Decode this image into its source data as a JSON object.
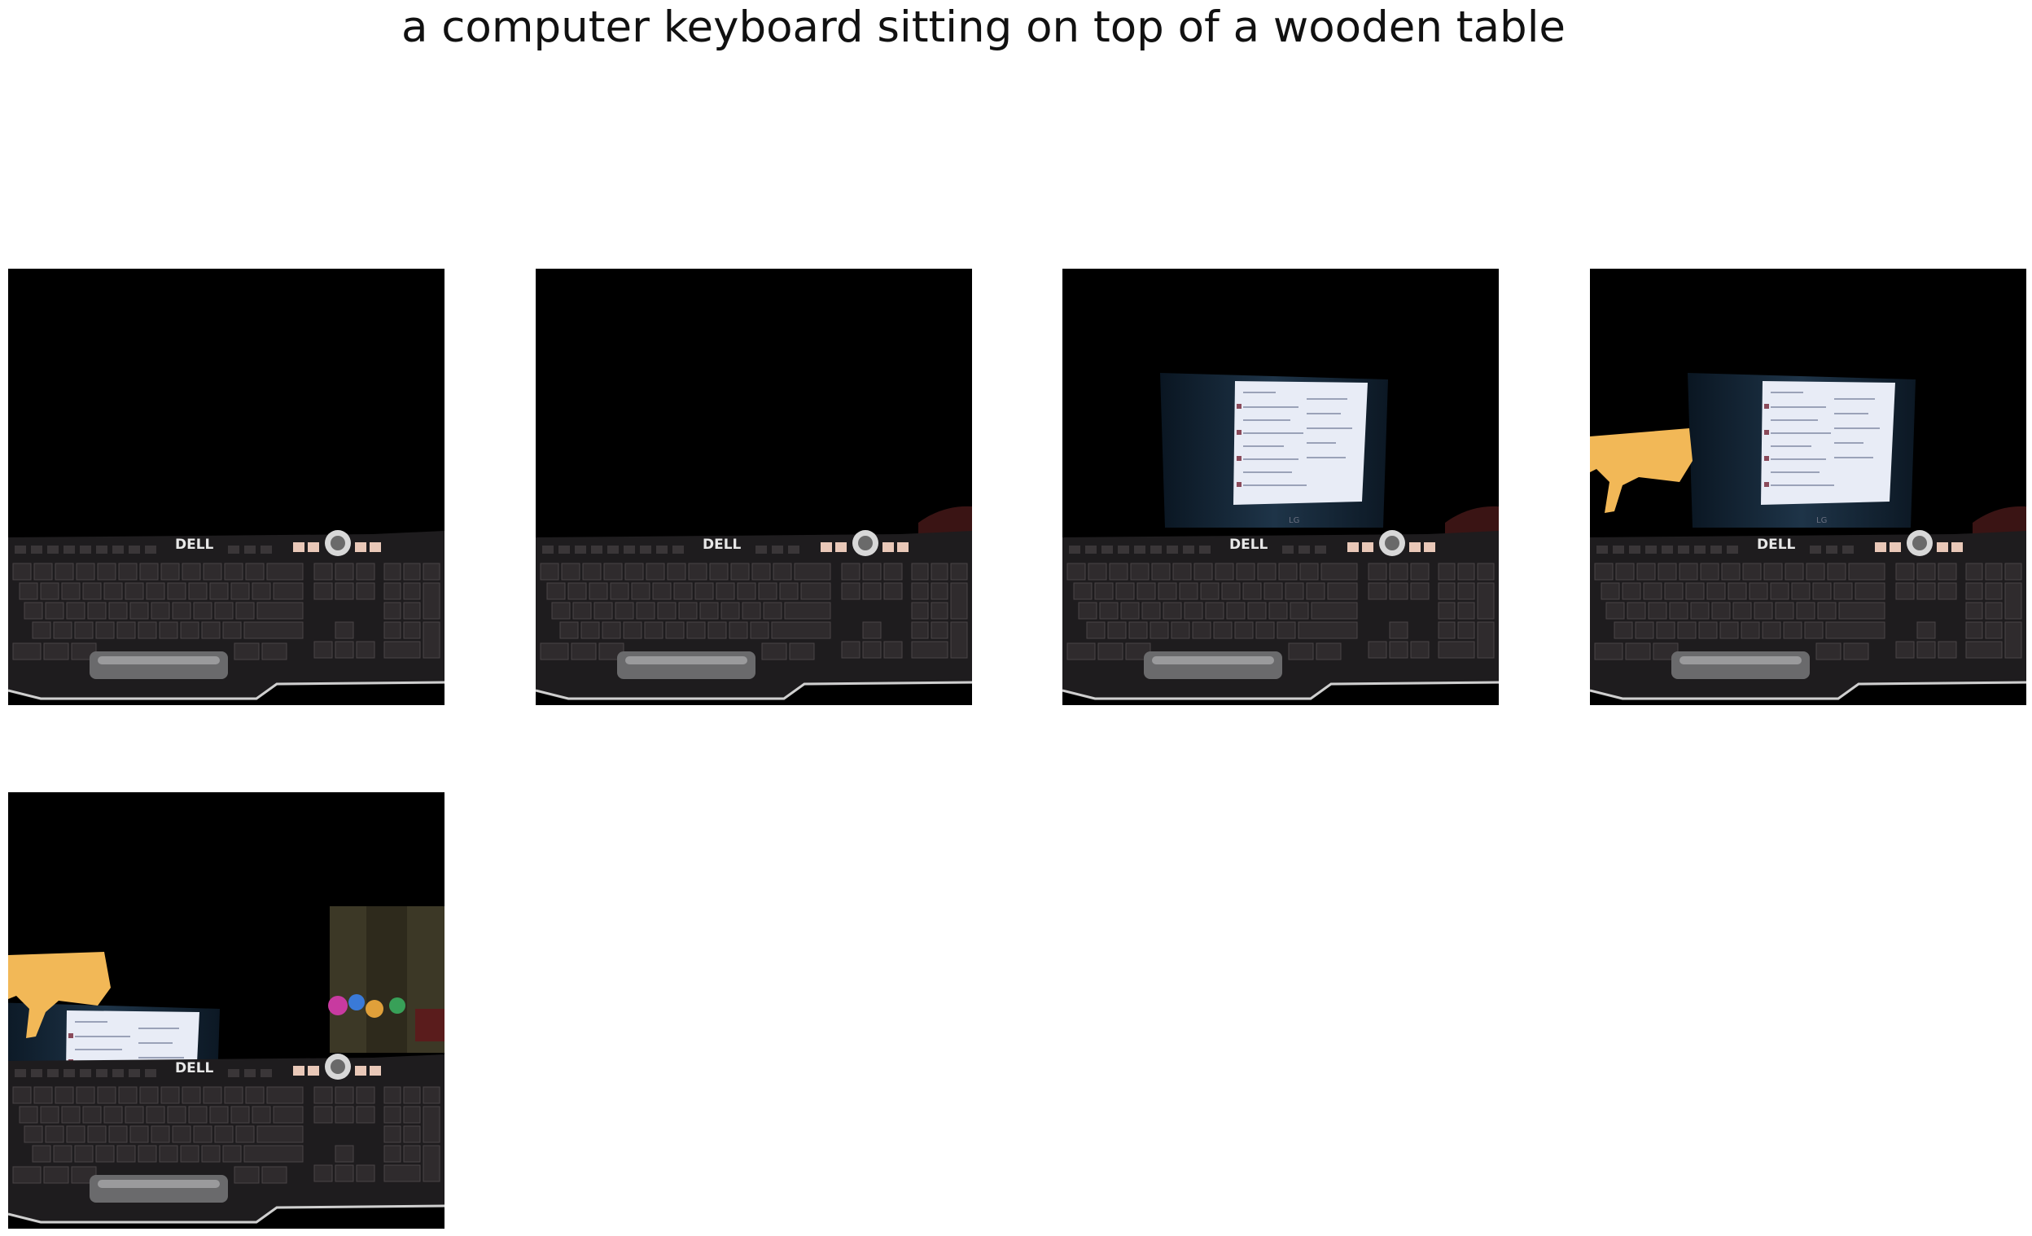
{
  "figure": {
    "title": "a computer keyboard sitting on top of a wooden table"
  },
  "panels": [
    {
      "index": 1,
      "content": "keyboard",
      "monitor": false,
      "hand": false,
      "toys": false
    },
    {
      "index": 2,
      "content": "keyboard",
      "monitor": false,
      "hand": false,
      "toys": false
    },
    {
      "index": 3,
      "content": "keyboard",
      "monitor": true,
      "hand": false,
      "toys": false
    },
    {
      "index": 4,
      "content": "keyboard",
      "monitor": true,
      "hand": true,
      "toys": false
    },
    {
      "index": 5,
      "content": "keyboard",
      "monitor": true,
      "hand": true,
      "toys": true
    }
  ],
  "keyboard_brand": "DELL",
  "colors": {
    "background": "#000000",
    "page": "#ffffff",
    "keyboard": "#1e1c1e",
    "keys": "#2f2b2d",
    "accent_keys": "#e9c8b8",
    "screen": "#e8ecf6",
    "hand": "#f2b857"
  }
}
